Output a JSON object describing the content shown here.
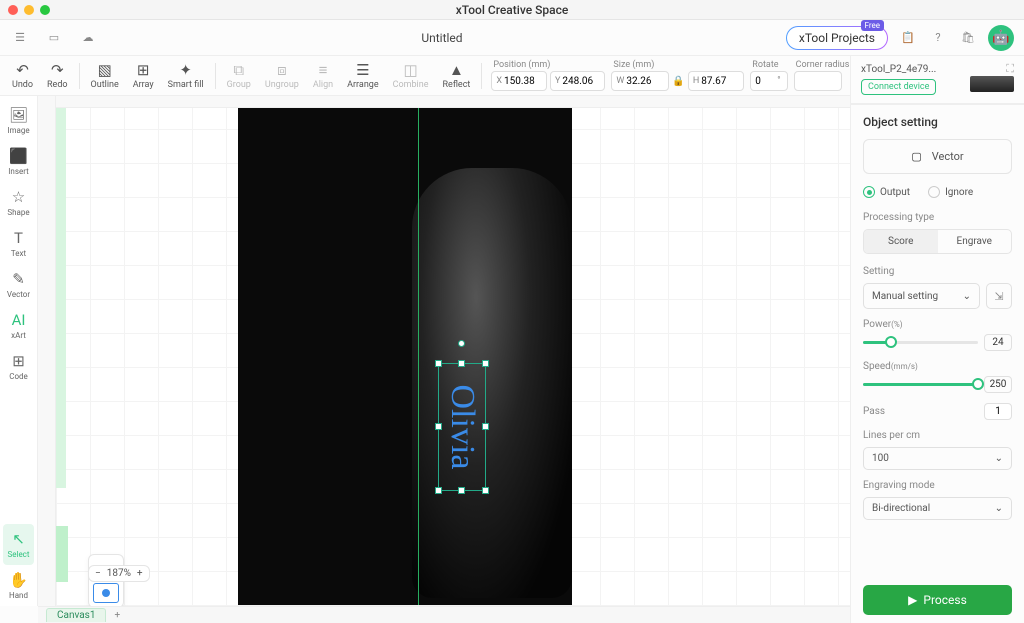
{
  "app": {
    "title": "xTool Creative Space",
    "document": "Untitled"
  },
  "topbar": {
    "projects": "xTool Projects",
    "free": "Free"
  },
  "toolbar": {
    "undo": "Undo",
    "redo": "Redo",
    "outline": "Outline",
    "array": "Array",
    "smartfill": "Smart fill",
    "group": "Group",
    "ungroup": "Ungroup",
    "align": "Align",
    "arrange": "Arrange",
    "combine": "Combine",
    "reflect": "Reflect"
  },
  "props": {
    "position_label": "Position (mm)",
    "x": "150.38",
    "y": "248.06",
    "size_label": "Size (mm)",
    "w": "32.26",
    "h": "87.67",
    "rotate_label": "Rotate",
    "rotate": "0",
    "radius_label": "Corner radius (m"
  },
  "sidebar": {
    "image": "Image",
    "insert": "Insert",
    "shape": "Shape",
    "text": "Text",
    "vector": "Vector",
    "xart": "xArt",
    "code": "Code",
    "select": "Select",
    "hand": "Hand"
  },
  "canvas": {
    "zoom": "187%",
    "tab": "Canvas1",
    "text": "Olivia"
  },
  "device": {
    "name": "xTool_P2_4e79...",
    "connect": "Connect device"
  },
  "obj": {
    "title": "Object setting",
    "vector": "Vector",
    "output": "Output",
    "ignore": "Ignore",
    "proc_type": "Processing type",
    "score": "Score",
    "engrave": "Engrave",
    "setting": "Setting",
    "manual": "Manual setting",
    "power": "Power",
    "power_unit": "(%)",
    "power_val": "24",
    "speed": "Speed",
    "speed_unit": "(mm/s)",
    "speed_val": "250",
    "pass": "Pass",
    "pass_val": "1",
    "lpc": "Lines per cm",
    "lpc_val": "100",
    "emode": "Engraving mode",
    "emode_val": "Bi-directional",
    "process": "Process"
  }
}
